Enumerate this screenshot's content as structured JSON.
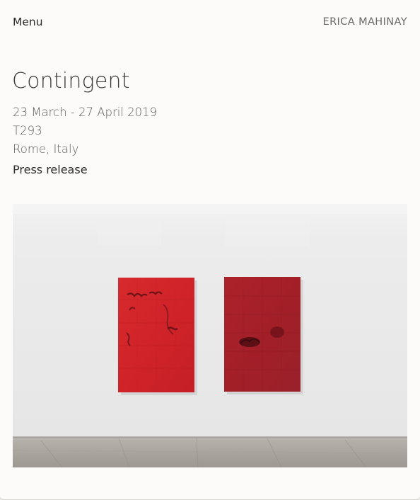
{
  "header": {
    "menu_label": "Menu",
    "artist_name": "ERICA MAHINAY"
  },
  "exhibition": {
    "title": "Contingent",
    "dates": "23 March - 27 April 2019",
    "venue": "T293",
    "location": "Rome, Italy",
    "press_release_label": "Press release"
  },
  "colors": {
    "background": "#fcfbfa",
    "wall": "#ececec",
    "floor": "#a9a49d",
    "painting_left": "#d2262b",
    "painting_right": "#a5202a"
  }
}
